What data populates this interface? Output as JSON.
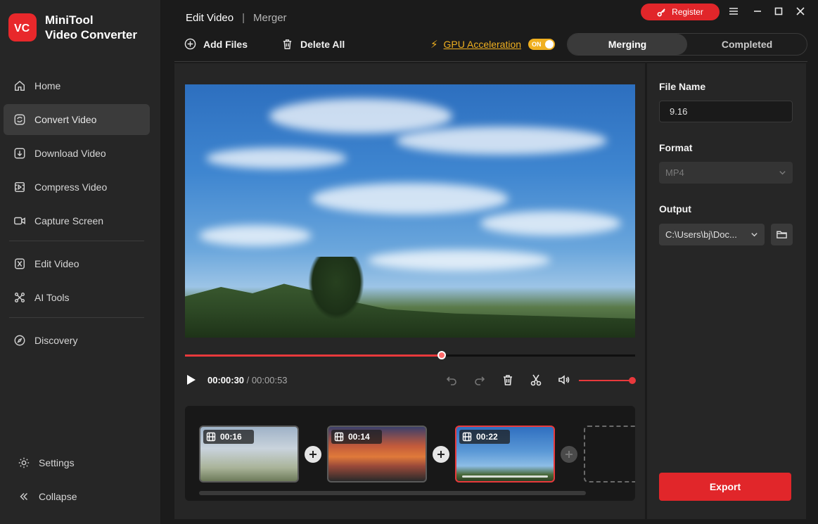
{
  "app": {
    "name_line1": "MiniTool",
    "name_line2": "Video Converter",
    "logo_text": "VC"
  },
  "sidebar": {
    "items": [
      {
        "label": "Home",
        "icon": "home-icon"
      },
      {
        "label": "Convert Video",
        "icon": "convert-icon",
        "active": true
      },
      {
        "label": "Download Video",
        "icon": "download-icon"
      },
      {
        "label": "Compress Video",
        "icon": "compress-icon"
      },
      {
        "label": "Capture Screen",
        "icon": "camera-icon"
      },
      {
        "label": "Edit Video",
        "icon": "edit-video-icon"
      },
      {
        "label": "AI Tools",
        "icon": "ai-tools-icon"
      },
      {
        "label": "Discovery",
        "icon": "compass-icon"
      }
    ],
    "settings_label": "Settings",
    "collapse_label": "Collapse"
  },
  "header": {
    "tab_edit": "Edit Video",
    "tab_separator": "|",
    "tab_merger": "Merger",
    "register_label": "Register"
  },
  "toolbar": {
    "add_files": "Add Files",
    "delete_all": "Delete All",
    "gpu_label": "GPU Acceleration",
    "gpu_toggle": "ON",
    "seg_merging": "Merging",
    "seg_completed": "Completed"
  },
  "player": {
    "current_time": "00:00:30",
    "separator": "/",
    "total_time": "00:00:53",
    "progress_fraction": 0.57,
    "volume_fraction": 1.0
  },
  "timeline": {
    "clips": [
      {
        "duration": "00:16",
        "selected": false
      },
      {
        "duration": "00:14",
        "selected": false
      },
      {
        "duration": "00:22",
        "selected": true
      }
    ]
  },
  "settings_panel": {
    "file_name_label": "File Name",
    "file_name_value": "9.16",
    "format_label": "Format",
    "format_value": "MP4",
    "output_label": "Output",
    "output_value": "C:\\Users\\bj\\Doc...",
    "export_label": "Export"
  },
  "colors": {
    "accent": "#e1262a",
    "gpu": "#f0b020",
    "bg": "#1b1b1b",
    "panel": "#262626"
  }
}
